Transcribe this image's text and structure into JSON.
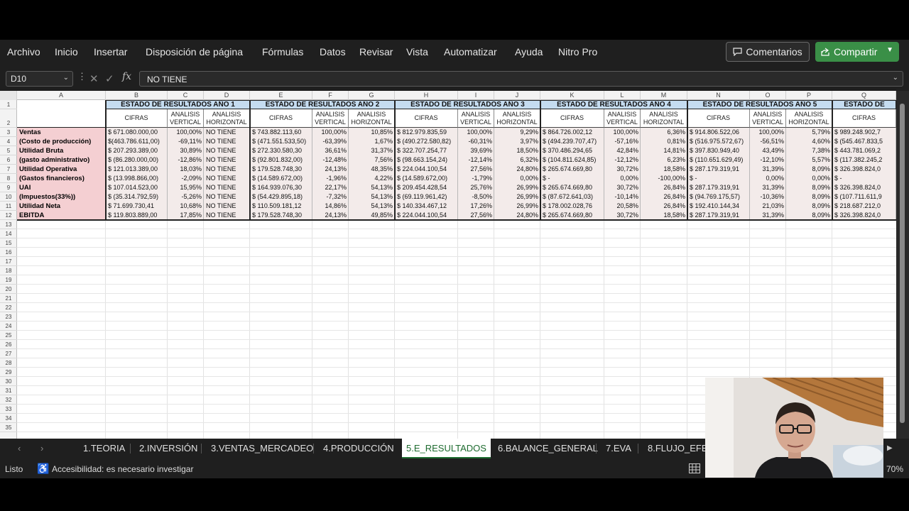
{
  "menu": [
    "Archivo",
    "Inicio",
    "Insertar",
    "Disposición de página",
    "Fórmulas",
    "Datos",
    "Revisar",
    "Vista",
    "Automatizar",
    "Ayuda",
    "Nitro Pro"
  ],
  "buttons": {
    "comments": "Comentarios",
    "share": "Compartir"
  },
  "formula_bar": {
    "cell_ref": "D10",
    "fx": "fx",
    "content": "NO TIENE"
  },
  "columns": [
    "A",
    "B",
    "C",
    "D",
    "E",
    "F",
    "G",
    "H",
    "I",
    "J",
    "K",
    "L",
    "M",
    "N",
    "O",
    "P",
    "Q"
  ],
  "row_numbers": [
    "1",
    "2",
    "3",
    "4",
    "5",
    "6",
    "7",
    "8",
    "9",
    "10",
    "11",
    "12",
    "13",
    "14",
    "15",
    "16",
    "17",
    "18",
    "19",
    "20",
    "21",
    "22",
    "23",
    "24",
    "25",
    "26",
    "27",
    "28",
    "29",
    "30",
    "31",
    "32",
    "33",
    "34",
    "35"
  ],
  "sections": [
    "ESTADO DE RESULTADOS AÑO 1",
    "ESTADO DE RESULTADOS AÑO 2",
    "ESTADO DE RESULTADOS AÑO 3",
    "ESTADO DE RESULTADOS AÑO 4",
    "ESTADO DE RESULTADOS AÑO 5",
    "ESTADO DE"
  ],
  "subheaders": {
    "cifras": "CIFRAS",
    "vertical": "ANALISIS VERTICAL",
    "horizontal": "ANALISIS HORIZONTAL"
  },
  "row_labels": [
    "Ventas",
    "(Costo de producción)",
    "Utilidad Bruta",
    "(gasto administrativo)",
    "Utilidad Operativa",
    "(Gastos financieros)",
    "UAI",
    "(Impuestos(33%))",
    "Utilidad Neta",
    "EBITDA"
  ],
  "table": [
    [
      "$ 671.080.000,00",
      "100,00%",
      "NO TIENE",
      "$ 743.882.113,60",
      "100,00%",
      "10,85%",
      "$ 812.979.835,59",
      "100,00%",
      "9,29%",
      "$ 864.726.002,12",
      "100,00%",
      "6,36%",
      "$ 914.806.522,06",
      "100,00%",
      "5,79%",
      "$ 989.248.902,7"
    ],
    [
      "$(463.786.611,00)",
      "-69,11%",
      "NO TIENE",
      "$ (471.551.533,50)",
      "-63,39%",
      "1,67%",
      "$ (490.272.580,82)",
      "-60,31%",
      "3,97%",
      "$ (494.239.707,47)",
      "-57,16%",
      "0,81%",
      "$ (516.975.572,67)",
      "-56,51%",
      "4,60%",
      "$ (545.467.833,5"
    ],
    [
      "$ 207.293.389,00",
      "30,89%",
      "NO TIENE",
      "$ 272.330.580,30",
      "36,61%",
      "31,37%",
      "$ 322.707.254,77",
      "39,69%",
      "18,50%",
      "$ 370.486.294,65",
      "42,84%",
      "14,81%",
      "$ 397.830.949,40",
      "43,49%",
      "7,38%",
      "$ 443.781.069,2"
    ],
    [
      "$ (86.280.000,00)",
      "-12,86%",
      "NO TIENE",
      "$ (92.801.832,00)",
      "-12,48%",
      "7,56%",
      "$ (98.663.154,24)",
      "-12,14%",
      "6,32%",
      "$ (104.811.624,85)",
      "-12,12%",
      "6,23%",
      "$ (110.651.629,49)",
      "-12,10%",
      "5,57%",
      "$ (117.382.245,2"
    ],
    [
      "$ 121.013.389,00",
      "18,03%",
      "NO TIENE",
      "$ 179.528.748,30",
      "24,13%",
      "48,35%",
      "$ 224.044.100,54",
      "27,56%",
      "24,80%",
      "$ 265.674.669,80",
      "30,72%",
      "18,58%",
      "$ 287.179.319,91",
      "31,39%",
      "8,09%",
      "$ 326.398.824,0"
    ],
    [
      "$ (13.998.866,00)",
      "-2,09%",
      "NO TIENE",
      "$ (14.589.672,00)",
      "-1,96%",
      "4,22%",
      "$ (14.589.672,00)",
      "-1,79%",
      "0,00%",
      "$ -",
      "0,00%",
      "-100,00%",
      "$ -",
      "0,00%",
      "0,00%",
      "$ -"
    ],
    [
      "$ 107.014.523,00",
      "15,95%",
      "NO TIENE",
      "$ 164.939.076,30",
      "22,17%",
      "54,13%",
      "$ 209.454.428,54",
      "25,76%",
      "26,99%",
      "$ 265.674.669,80",
      "30,72%",
      "26,84%",
      "$ 287.179.319,91",
      "31,39%",
      "8,09%",
      "$ 326.398.824,0"
    ],
    [
      "$ (35.314.792,59)",
      "-5,26%",
      "NO TIENE",
      "$ (54.429.895,18)",
      "-7,32%",
      "54,13%",
      "$ (69.119.961,42)",
      "-8,50%",
      "26,99%",
      "$ (87.672.641,03)",
      "-10,14%",
      "26,84%",
      "$ (94.769.175,57)",
      "-10,36%",
      "8,09%",
      "$ (107.711.611,9"
    ],
    [
      "$ 71.699.730,41",
      "10,68%",
      "NO TIENE",
      "$ 110.509.181,12",
      "14,86%",
      "54,13%",
      "$ 140.334.467,12",
      "17,26%",
      "26,99%",
      "$ 178.002.028,76",
      "20,58%",
      "26,84%",
      "$ 192.410.144,34",
      "21,03%",
      "8,09%",
      "$ 218.687.212,0"
    ],
    [
      "$ 119.803.889,00",
      "17,85%",
      "NO TIENE",
      "$ 179.528.748,30",
      "24,13%",
      "49,85%",
      "$ 224.044.100,54",
      "27,56%",
      "24,80%",
      "$ 265.674.669,80",
      "30,72%",
      "18,58%",
      "$ 287.179.319,91",
      "31,39%",
      "8,09%",
      "$ 326.398.824,0"
    ]
  ],
  "sheet_tabs": [
    "1.TEORIA",
    "2.INVERSIÓN",
    "3.VENTAS_MERCADEO",
    "4.PRODUCCIÓN",
    "5.E_RESULTADOS",
    "6.BALANCE_GENERAL",
    "7.EVA",
    "8.FLUJO_EFECT"
  ],
  "active_tab": "5.E_RESULTADOS",
  "status": {
    "ready": "Listo",
    "accessibility": "Accesibilidad: es necesario investigar",
    "zoom": "70%"
  },
  "colors": {
    "section_header": "#c5dcf0",
    "row_label": "#f4cfd2",
    "data_cell": "#f3ebea",
    "share_button": "#3a8f47"
  }
}
